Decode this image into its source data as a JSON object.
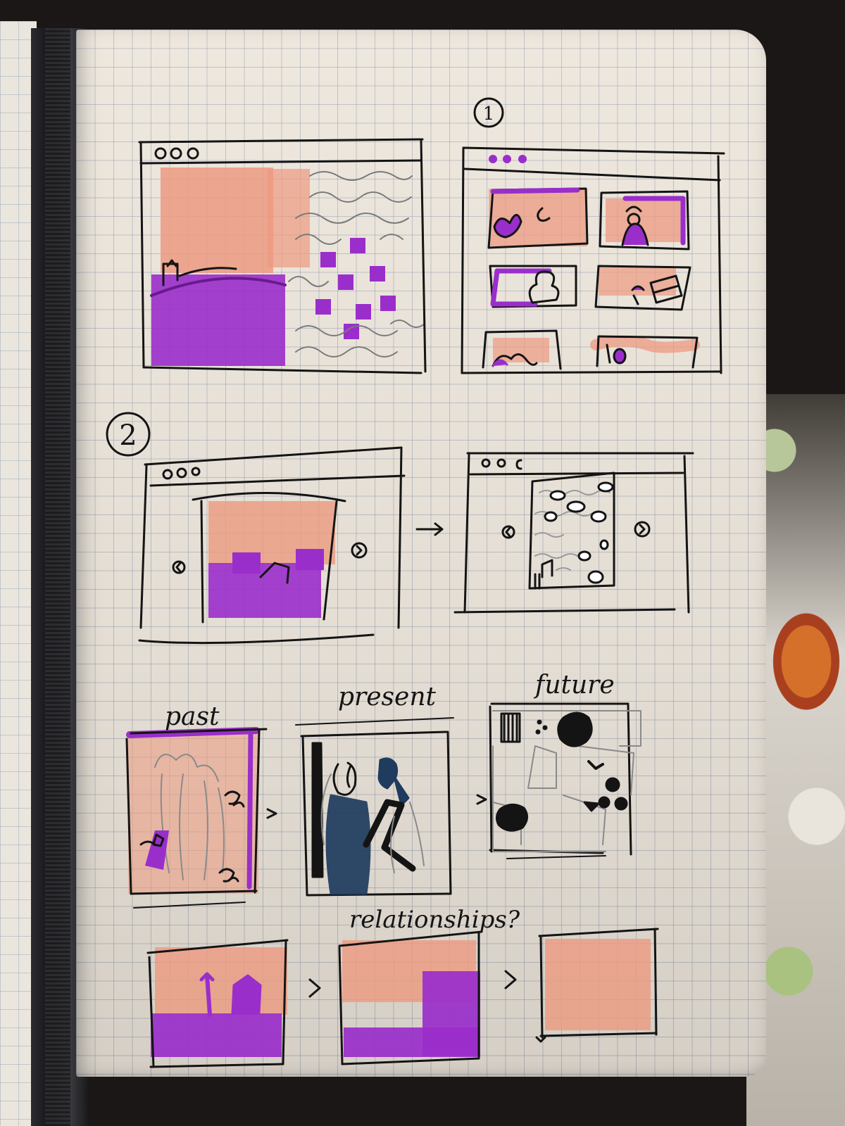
{
  "notebook": {
    "section_markers": [
      "1",
      "2"
    ],
    "labels": {
      "past": "past",
      "present": "present",
      "future": "future",
      "relationships": "relationships?"
    },
    "arrows": [
      "→",
      ">",
      ">",
      ">",
      ">"
    ]
  },
  "colors": {
    "paper": "#ede6dc",
    "grid": "#7d8ca5",
    "ink": "#141414",
    "peach": "#ec9a80",
    "purple": "#9a2ecb",
    "navy": "#1f3b5e"
  }
}
